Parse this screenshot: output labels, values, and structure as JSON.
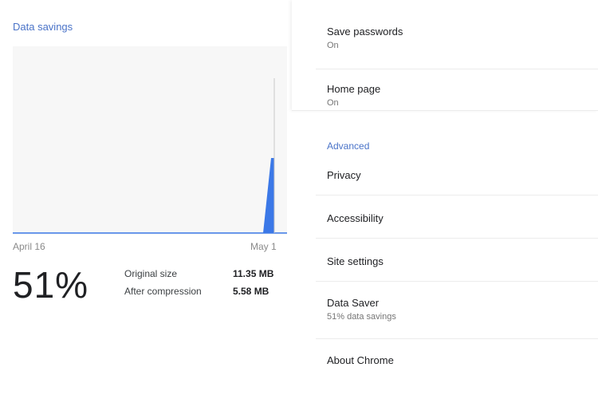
{
  "data_saver": {
    "section_title": "Data savings",
    "date_start": "April 16",
    "date_end": "May 1",
    "percent": "51%",
    "original_size_label": "Original size",
    "original_size_value": "11.35 MB",
    "after_compression_label": "After compression",
    "after_compression_value": "5.58 MB",
    "chart_color": "#3b78e7"
  },
  "settings": {
    "items_top": [
      {
        "title": "Save passwords",
        "subtitle": "On"
      },
      {
        "title": "Home page",
        "subtitle": "On"
      }
    ],
    "advanced_header": "Advanced",
    "items": [
      {
        "title": "Privacy",
        "subtitle": ""
      },
      {
        "title": "Accessibility",
        "subtitle": ""
      },
      {
        "title": "Site settings",
        "subtitle": ""
      },
      {
        "title": "Data Saver",
        "subtitle": "51% data savings"
      },
      {
        "title": "About Chrome",
        "subtitle": ""
      }
    ]
  }
}
